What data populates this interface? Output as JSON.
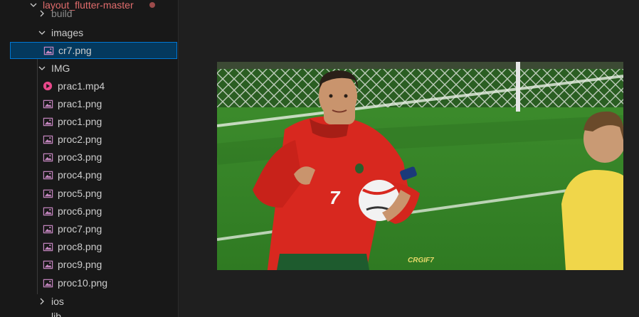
{
  "explorer": {
    "root": {
      "label": "layout_flutter-master"
    },
    "items": [
      {
        "label": "build",
        "kind": "folder",
        "expanded": false
      },
      {
        "label": "images",
        "kind": "folder",
        "expanded": true
      },
      {
        "label": "cr7.png",
        "kind": "image",
        "selected": true
      },
      {
        "label": "IMG",
        "kind": "folder",
        "expanded": true
      },
      {
        "label": "prac1.mp4",
        "kind": "video"
      },
      {
        "label": "prac1.png",
        "kind": "image"
      },
      {
        "label": "proc1.png",
        "kind": "image"
      },
      {
        "label": "proc2.png",
        "kind": "image"
      },
      {
        "label": "proc3.png",
        "kind": "image"
      },
      {
        "label": "proc4.png",
        "kind": "image"
      },
      {
        "label": "proc5.png",
        "kind": "image"
      },
      {
        "label": "proc6.png",
        "kind": "image"
      },
      {
        "label": "proc7.png",
        "kind": "image"
      },
      {
        "label": "proc8.png",
        "kind": "image"
      },
      {
        "label": "proc9.png",
        "kind": "image"
      },
      {
        "label": "proc10.png",
        "kind": "image"
      },
      {
        "label": "ios",
        "kind": "folder",
        "expanded": false
      },
      {
        "label": "lib",
        "kind": "folder",
        "expanded": false
      }
    ]
  },
  "image_preview": {
    "jersey_number": "7",
    "watermark": "CRGIF7"
  },
  "colors": {
    "selection_bg": "#04395e",
    "selection_border": "#0078d4",
    "image_icon": "#c586c0",
    "video_icon": "#e8488a",
    "root_text": "#e06c6c"
  }
}
